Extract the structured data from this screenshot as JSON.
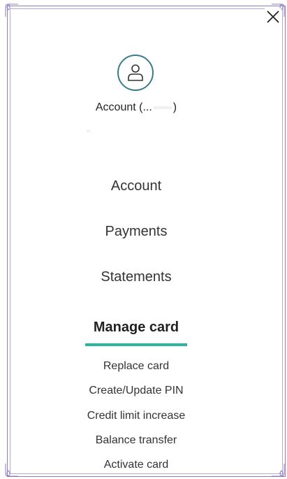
{
  "header": {
    "close_icon": "close-icon",
    "avatar_icon": "user-icon",
    "account_label": "Account (...",
    "account_suffix": ")"
  },
  "nav": {
    "items": [
      {
        "label": "Account"
      },
      {
        "label": "Payments"
      },
      {
        "label": "Statements"
      },
      {
        "label": "Manage card",
        "active": true
      }
    ]
  },
  "manage_card": {
    "items": [
      {
        "label": "Replace card"
      },
      {
        "label": "Create/Update PIN"
      },
      {
        "label": "Credit limit increase"
      },
      {
        "label": "Balance transfer"
      },
      {
        "label": "Activate card"
      }
    ]
  },
  "colors": {
    "accent": "#2bb5a0",
    "avatar_ring": "#3b7c8c",
    "frame": "#8e7cc3"
  }
}
